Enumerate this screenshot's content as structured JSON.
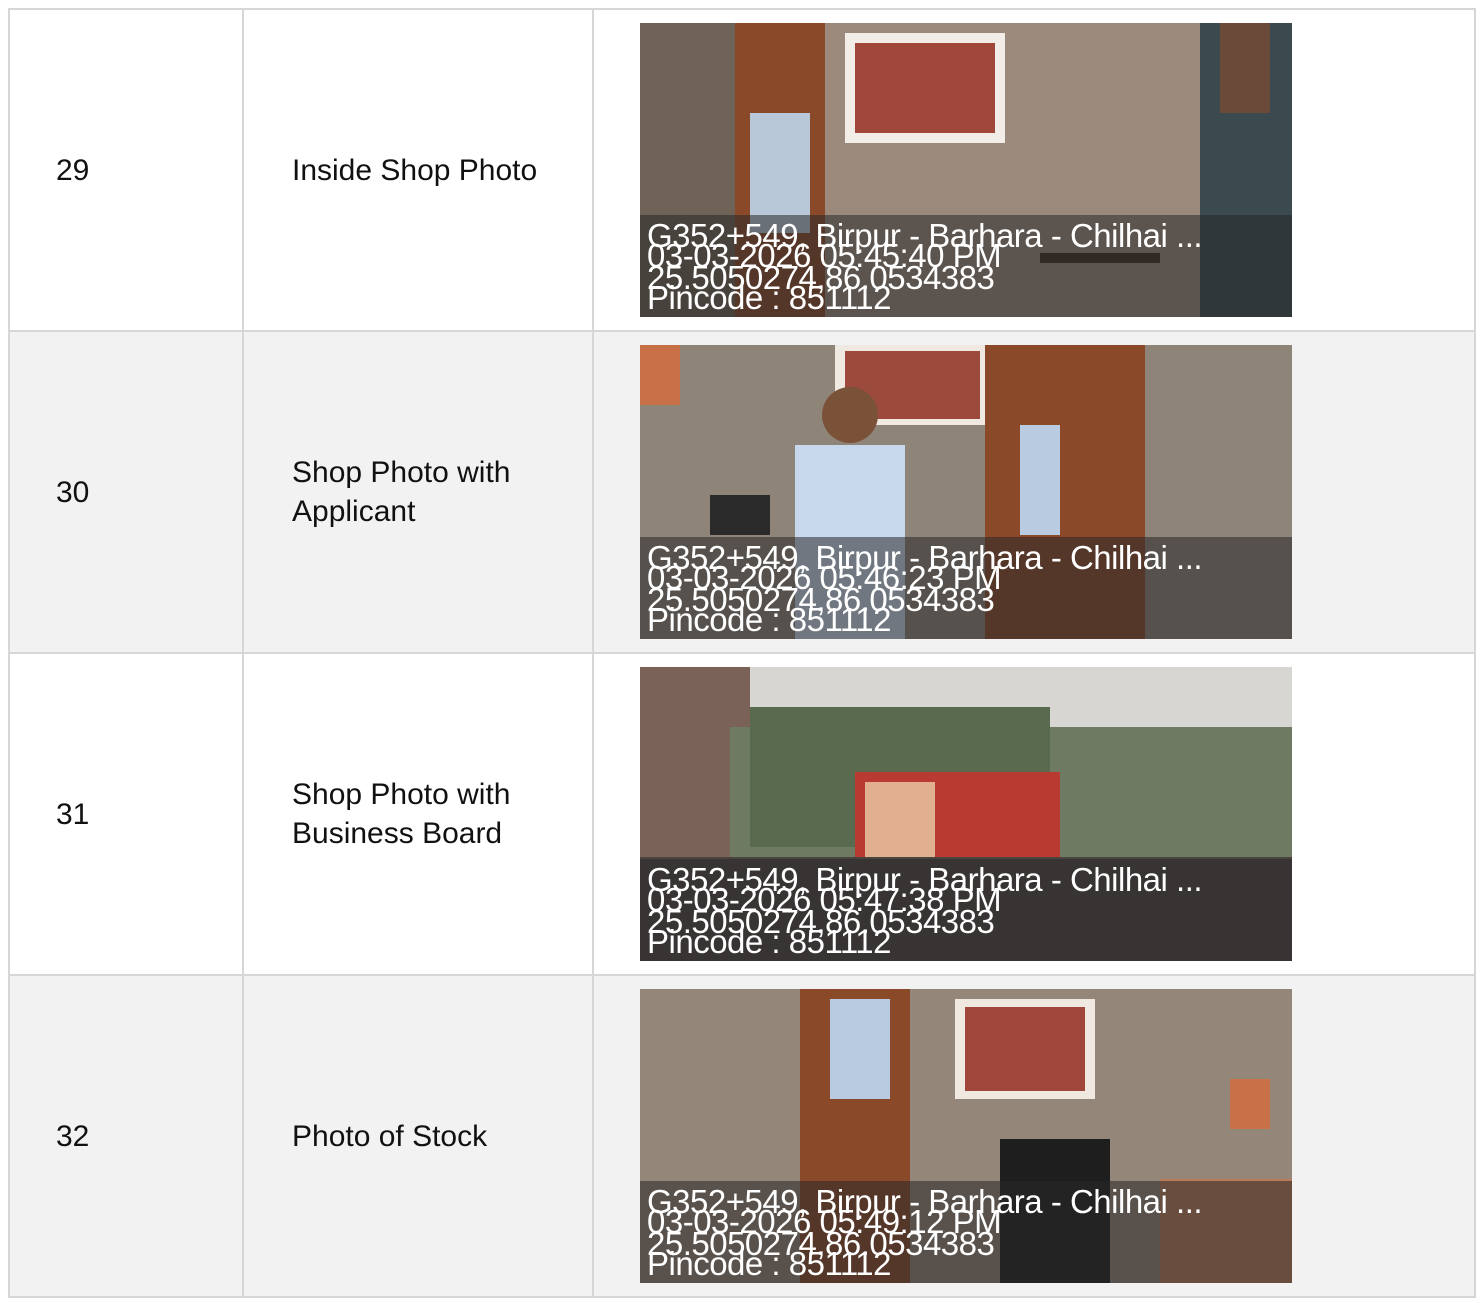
{
  "rows": [
    {
      "number": "29",
      "label": "Inside Shop Photo",
      "stamp": {
        "address": "G352+549, Birpur - Barhara - Chilhai ...",
        "datetime": "03-03-2026 05:45:40 PM",
        "coords": "25.5050274,86.0534383",
        "pincode": "Pincode : 851112"
      }
    },
    {
      "number": "30",
      "label": "Shop Photo with Applicant",
      "stamp": {
        "address": "G352+549, Birpur - Barhara - Chilhai ...",
        "datetime": "03-03-2026 05:46:23 PM",
        "coords": "25.5050274,86.0534383",
        "pincode": "Pincode : 851112"
      }
    },
    {
      "number": "31",
      "label": "Shop Photo with Business Board",
      "stamp": {
        "address": "G352+549, Birpur - Barhara - Chilhai ...",
        "datetime": "03-03-2026 05:47:38 PM",
        "coords": "25.5050274,86.0534383",
        "pincode": "Pincode : 851112"
      }
    },
    {
      "number": "32",
      "label": "Photo of Stock",
      "stamp": {
        "address": "G352+549, Birpur - Barhara - Chilhai ...",
        "datetime": "03-03-2026 05:49:12 PM",
        "coords": "25.5050274,86.0534383",
        "pincode": "Pincode : 851112"
      }
    }
  ]
}
